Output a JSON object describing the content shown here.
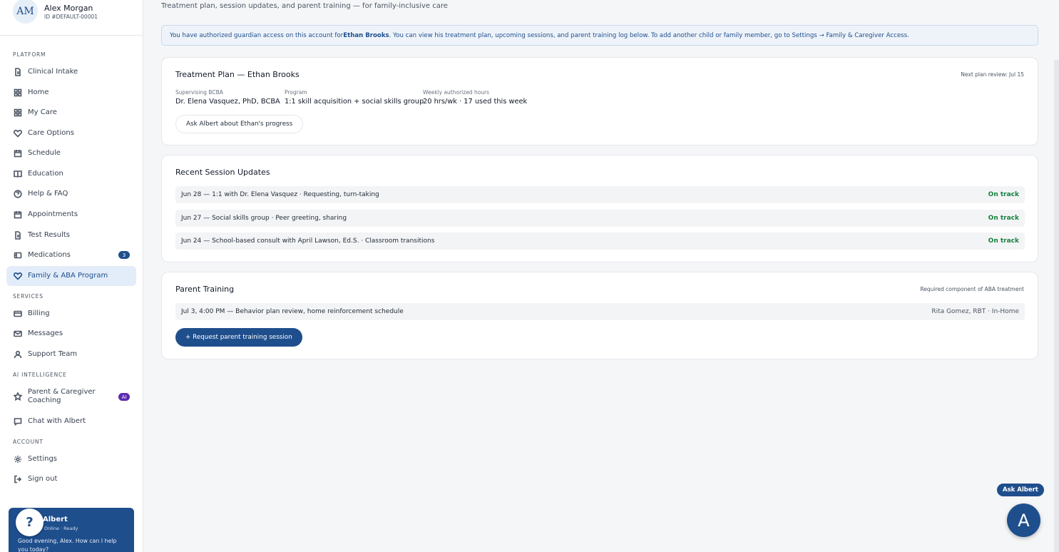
{
  "profile": {
    "initials": "AM",
    "name": "Alex Morgan",
    "id": "ID #DEFAULT-00001"
  },
  "sidebar": {
    "sections": {
      "platform": "PLATFORM",
      "services": "SERVICES",
      "ai": "AI INTELLIGENCE",
      "account": "ACCOUNT"
    },
    "items": [
      {
        "label": "Clinical Intake",
        "icon": "document-icon"
      },
      {
        "label": "Home",
        "icon": "grid-icon"
      },
      {
        "label": "My Care",
        "icon": "grid-icon"
      },
      {
        "label": "Care Options",
        "icon": "heart-icon"
      },
      {
        "label": "Schedule",
        "icon": "calendar-icon"
      },
      {
        "label": "Education",
        "icon": "book-icon"
      },
      {
        "label": "Help & FAQ",
        "icon": "help-circle-icon"
      },
      {
        "label": "Appointments",
        "icon": "calendar-icon"
      },
      {
        "label": "Test Results",
        "icon": "document-icon"
      },
      {
        "label": "Medications",
        "icon": "pill-icon",
        "badge": "3"
      },
      {
        "label": "Family & ABA Program",
        "icon": "heart-icon"
      },
      {
        "label": "Billing",
        "icon": "credit-card-icon"
      },
      {
        "label": "Messages",
        "icon": "mail-icon"
      },
      {
        "label": "Support Team",
        "icon": "users-icon"
      },
      {
        "label": "Parent & Caregiver Coaching",
        "icon": "star-icon",
        "badge": "AI"
      },
      {
        "label": "Chat with Albert",
        "icon": "chat-icon"
      },
      {
        "label": "Settings",
        "icon": "gear-icon"
      },
      {
        "label": "Sign out",
        "icon": "logout-icon"
      }
    ],
    "active_item": "Family & ABA Program"
  },
  "albert_card": {
    "avatar": "?",
    "name": "Albert",
    "status": "Online · Ready",
    "message": "Good evening, Alex. How can I help you today?"
  },
  "main": {
    "subtitle": "Treatment plan, session updates, and parent training — for family-inclusive care",
    "alert": {
      "pre": "You have authorized guardian access on this account for ",
      "child": "Ethan Brooks",
      "post": ". You can view his treatment plan, upcoming sessions, and parent training log below. To add another child or family member, go to Settings → Family & Caregiver Access."
    },
    "treatment_plan": {
      "title": "Treatment Plan — Ethan Brooks",
      "meta": "Next plan review: Jul 15",
      "fields": [
        {
          "label": "Supervising BCBA",
          "value": "Dr. Elena Vasquez, PhD, BCBA"
        },
        {
          "label": "Program",
          "value": "1:1 skill acquisition + social skills group"
        },
        {
          "label": "Weekly authorized hours",
          "value": "20 hrs/wk · 17 used this week"
        }
      ],
      "button": "Ask Albert about Ethan's progress"
    },
    "sessions": {
      "title": "Recent Session Updates",
      "rows": [
        {
          "text": "Jun 28 — 1:1 with Dr. Elena Vasquez · Requesting, turn-taking",
          "status": "On track"
        },
        {
          "text": "Jun 27 — Social skills group · Peer greeting, sharing",
          "status": "On track"
        },
        {
          "text": "Jun 24 — School-based consult with April Lawson, Ed.S. · Classroom transitions",
          "status": "On track"
        }
      ]
    },
    "parent_training": {
      "title": "Parent Training",
      "meta": "Required component of ABA treatment",
      "rows": [
        {
          "text": "Jul 3, 4:00 PM — Behavior plan review, home reinforcement schedule",
          "right": "Rita Gomez, RBT · In-Home"
        }
      ],
      "button": "+ Request parent training session"
    }
  },
  "floating": {
    "ask_label": "Ask Albert",
    "fab_letter": "A"
  },
  "colors": {
    "brand": "#1f4e8c",
    "success": "#15803d",
    "ai_badge": "#5b2bb0"
  }
}
